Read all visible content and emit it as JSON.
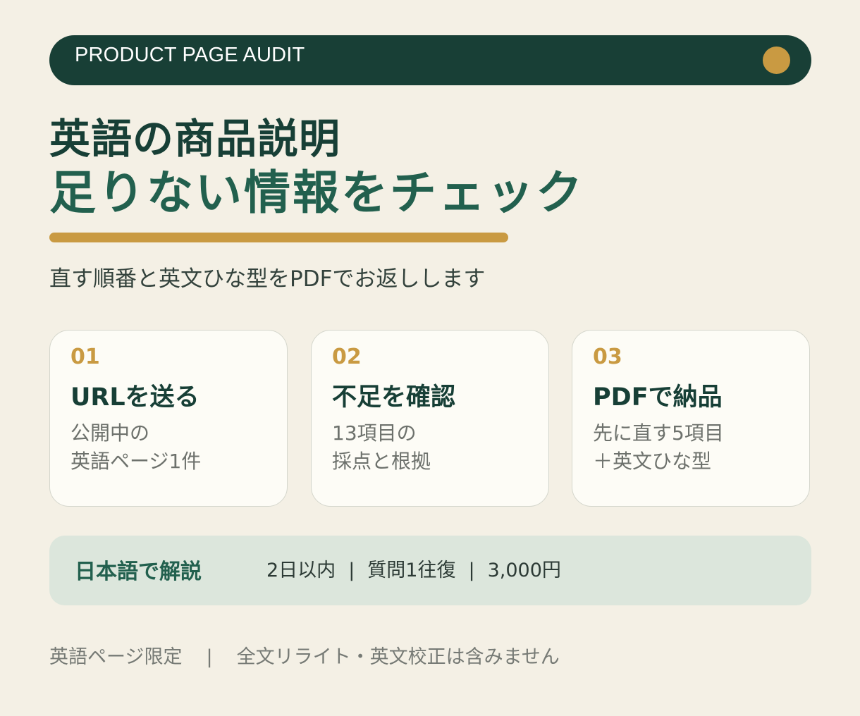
{
  "header": {
    "label": "PRODUCT PAGE AUDIT",
    "dot_color": "#c99a42"
  },
  "headline": {
    "line1": "英語の商品説明",
    "line2": "足りない情報をチェック"
  },
  "subtitle": "直す順番と英文ひな型をPDFでお返しします",
  "steps": [
    {
      "num": "01",
      "title": "URLを送る",
      "desc1": "公開中の",
      "desc2": "英語ページ1件"
    },
    {
      "num": "02",
      "title": "不足を確認",
      "desc1": "13項目の",
      "desc2": "採点と根拠"
    },
    {
      "num": "03",
      "title": "PDFで納品",
      "desc1": "先に直す5項目",
      "desc2": "＋英文ひな型"
    }
  ],
  "info": {
    "label": "日本語で解説",
    "turnaround": "2日以内",
    "questions": "質問1往復",
    "price": "3,000円",
    "separator": "|"
  },
  "footer": {
    "scope": "英語ページ限定",
    "separator": "|",
    "exclusion": "全文リライト・英文校正は含みません"
  },
  "colors": {
    "background": "#f4f0e5",
    "dark_green": "#183f36",
    "accent_gold": "#c99a42",
    "band": "#dce6dc"
  }
}
